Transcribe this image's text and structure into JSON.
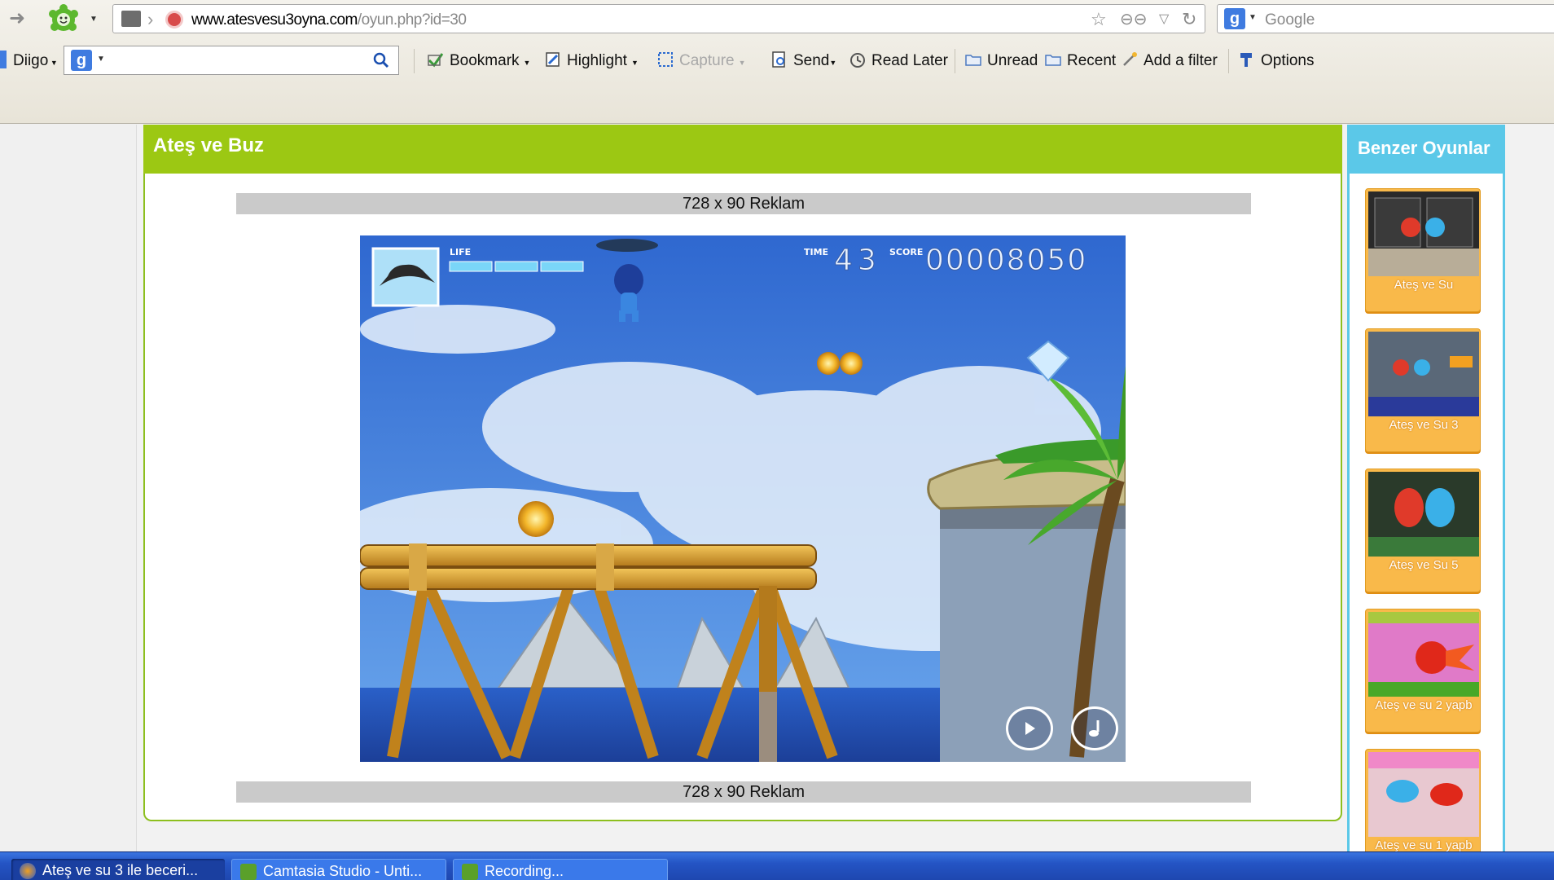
{
  "browser": {
    "url_domain": "www.atesvesu3oyna.com",
    "url_path": "/oyun.php?id=30",
    "search_placeholder": "Google"
  },
  "toolbar": {
    "diigo_label": "Diigo",
    "bookmark_label": "Bookmark",
    "highlight_label": "Highlight",
    "capture_label": "Capture",
    "send_label": "Send",
    "read_later_label": "Read Later",
    "unread_label": "Unread",
    "recent_label": "Recent",
    "add_filter_label": "Add a filter",
    "options_label": "Options"
  },
  "game": {
    "title": "Ateş ve Buz",
    "ad_top": "728 x 90 Reklam",
    "ad_bottom": "728 x 90 Reklam",
    "hud": {
      "life_label": "LIFE",
      "time_label": "TIME",
      "time_value": "43",
      "score_label": "SCORE",
      "score_value": "00008050"
    }
  },
  "sidebar": {
    "title": "Benzer Oyunlar",
    "games": [
      {
        "label": "Ateş ve Su"
      },
      {
        "label": "Ateş ve Su 3"
      },
      {
        "label": "Ateş ve Su 5"
      },
      {
        "label": "Ateş ve su 2 yapb"
      },
      {
        "label": "Ateş ve su 1 yapb"
      }
    ]
  },
  "taskbar": {
    "items": [
      {
        "label": "Ateş ve su 3 ile beceri..."
      },
      {
        "label": "Camtasia Studio - Unti..."
      },
      {
        "label": "Recording..."
      }
    ]
  },
  "colors": {
    "title_bar": "#9cc813",
    "sidebar_accent": "#5bc8e8",
    "card_orange": "#f9b94a",
    "taskbar_blue": "#2454c4"
  }
}
